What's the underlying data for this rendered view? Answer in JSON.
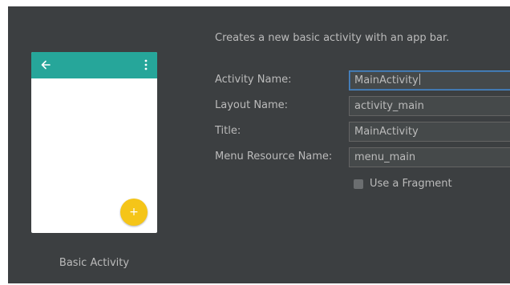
{
  "preview": {
    "template_name": "Basic Activity",
    "fab_symbol": "+",
    "appbar_color": "#26a69a",
    "fab_color": "#f5c518"
  },
  "description": "Creates a new basic activity with an app bar.",
  "fields": {
    "activity_name": {
      "label": "Activity Name:",
      "value": "MainActivity"
    },
    "layout_name": {
      "label": "Layout Name:",
      "value": "activity_main"
    },
    "title": {
      "label": "Title:",
      "value": "MainActivity"
    },
    "menu_resource_name": {
      "label": "Menu Resource Name:",
      "value": "menu_main"
    }
  },
  "fragment_option": {
    "label": "Use a Fragment",
    "checked": false
  }
}
